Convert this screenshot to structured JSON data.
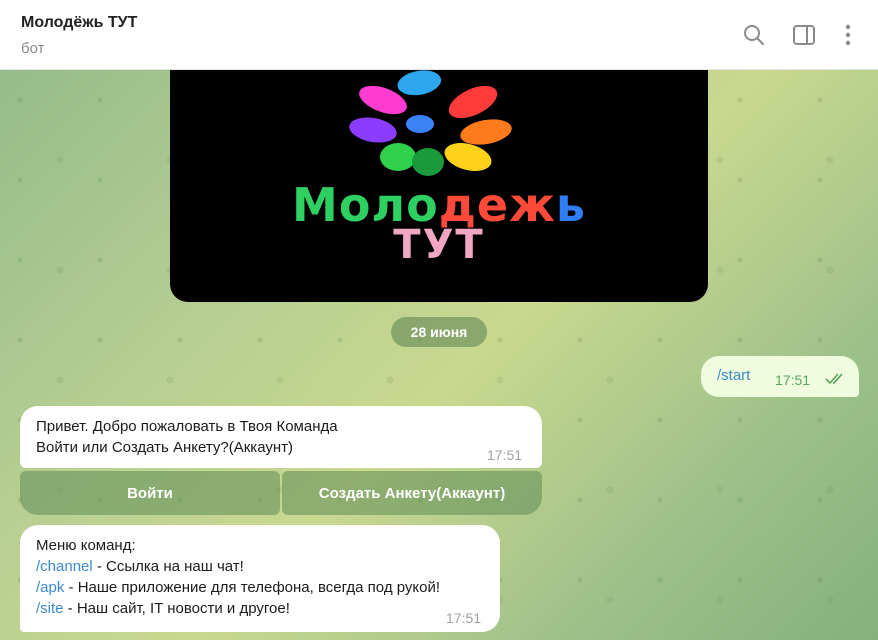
{
  "header": {
    "title": "Молодёжь ТУТ",
    "subtitle": "бот",
    "icons": [
      "search-icon",
      "sidebar-toggle-icon",
      "more-vert-icon"
    ]
  },
  "image": {
    "logo_line1": [
      "Моло",
      "деж",
      "ь"
    ],
    "logo_line2": "ТУТ"
  },
  "date_separator": "28 июня",
  "outgoing": {
    "text": "/start",
    "time": "17:51",
    "status": "read"
  },
  "message1": {
    "line1": "Привет. Добро пожаловать в Твоя Команда",
    "line2": "Войти или Создать Анкету?(Аккаунт)",
    "time": "17:51"
  },
  "keyboard": {
    "left": "Войти",
    "right": "Создать Анкету(Аккаунт)"
  },
  "message2": {
    "title": "Меню команд:",
    "commands": [
      {
        "cmd": "/channel",
        "desc": " - Ссылка на наш чат!"
      },
      {
        "cmd": "/apk",
        "desc": " - Наше приложение для телефона, всегда под рукой!"
      },
      {
        "cmd": "/site",
        "desc": " - Наш сайт, IT новости и другое!"
      }
    ],
    "time": "17:51"
  },
  "colors": {
    "accent": "#3a8bc8",
    "outgoing_bg": "#effdde",
    "check_color": "#58a35a"
  }
}
